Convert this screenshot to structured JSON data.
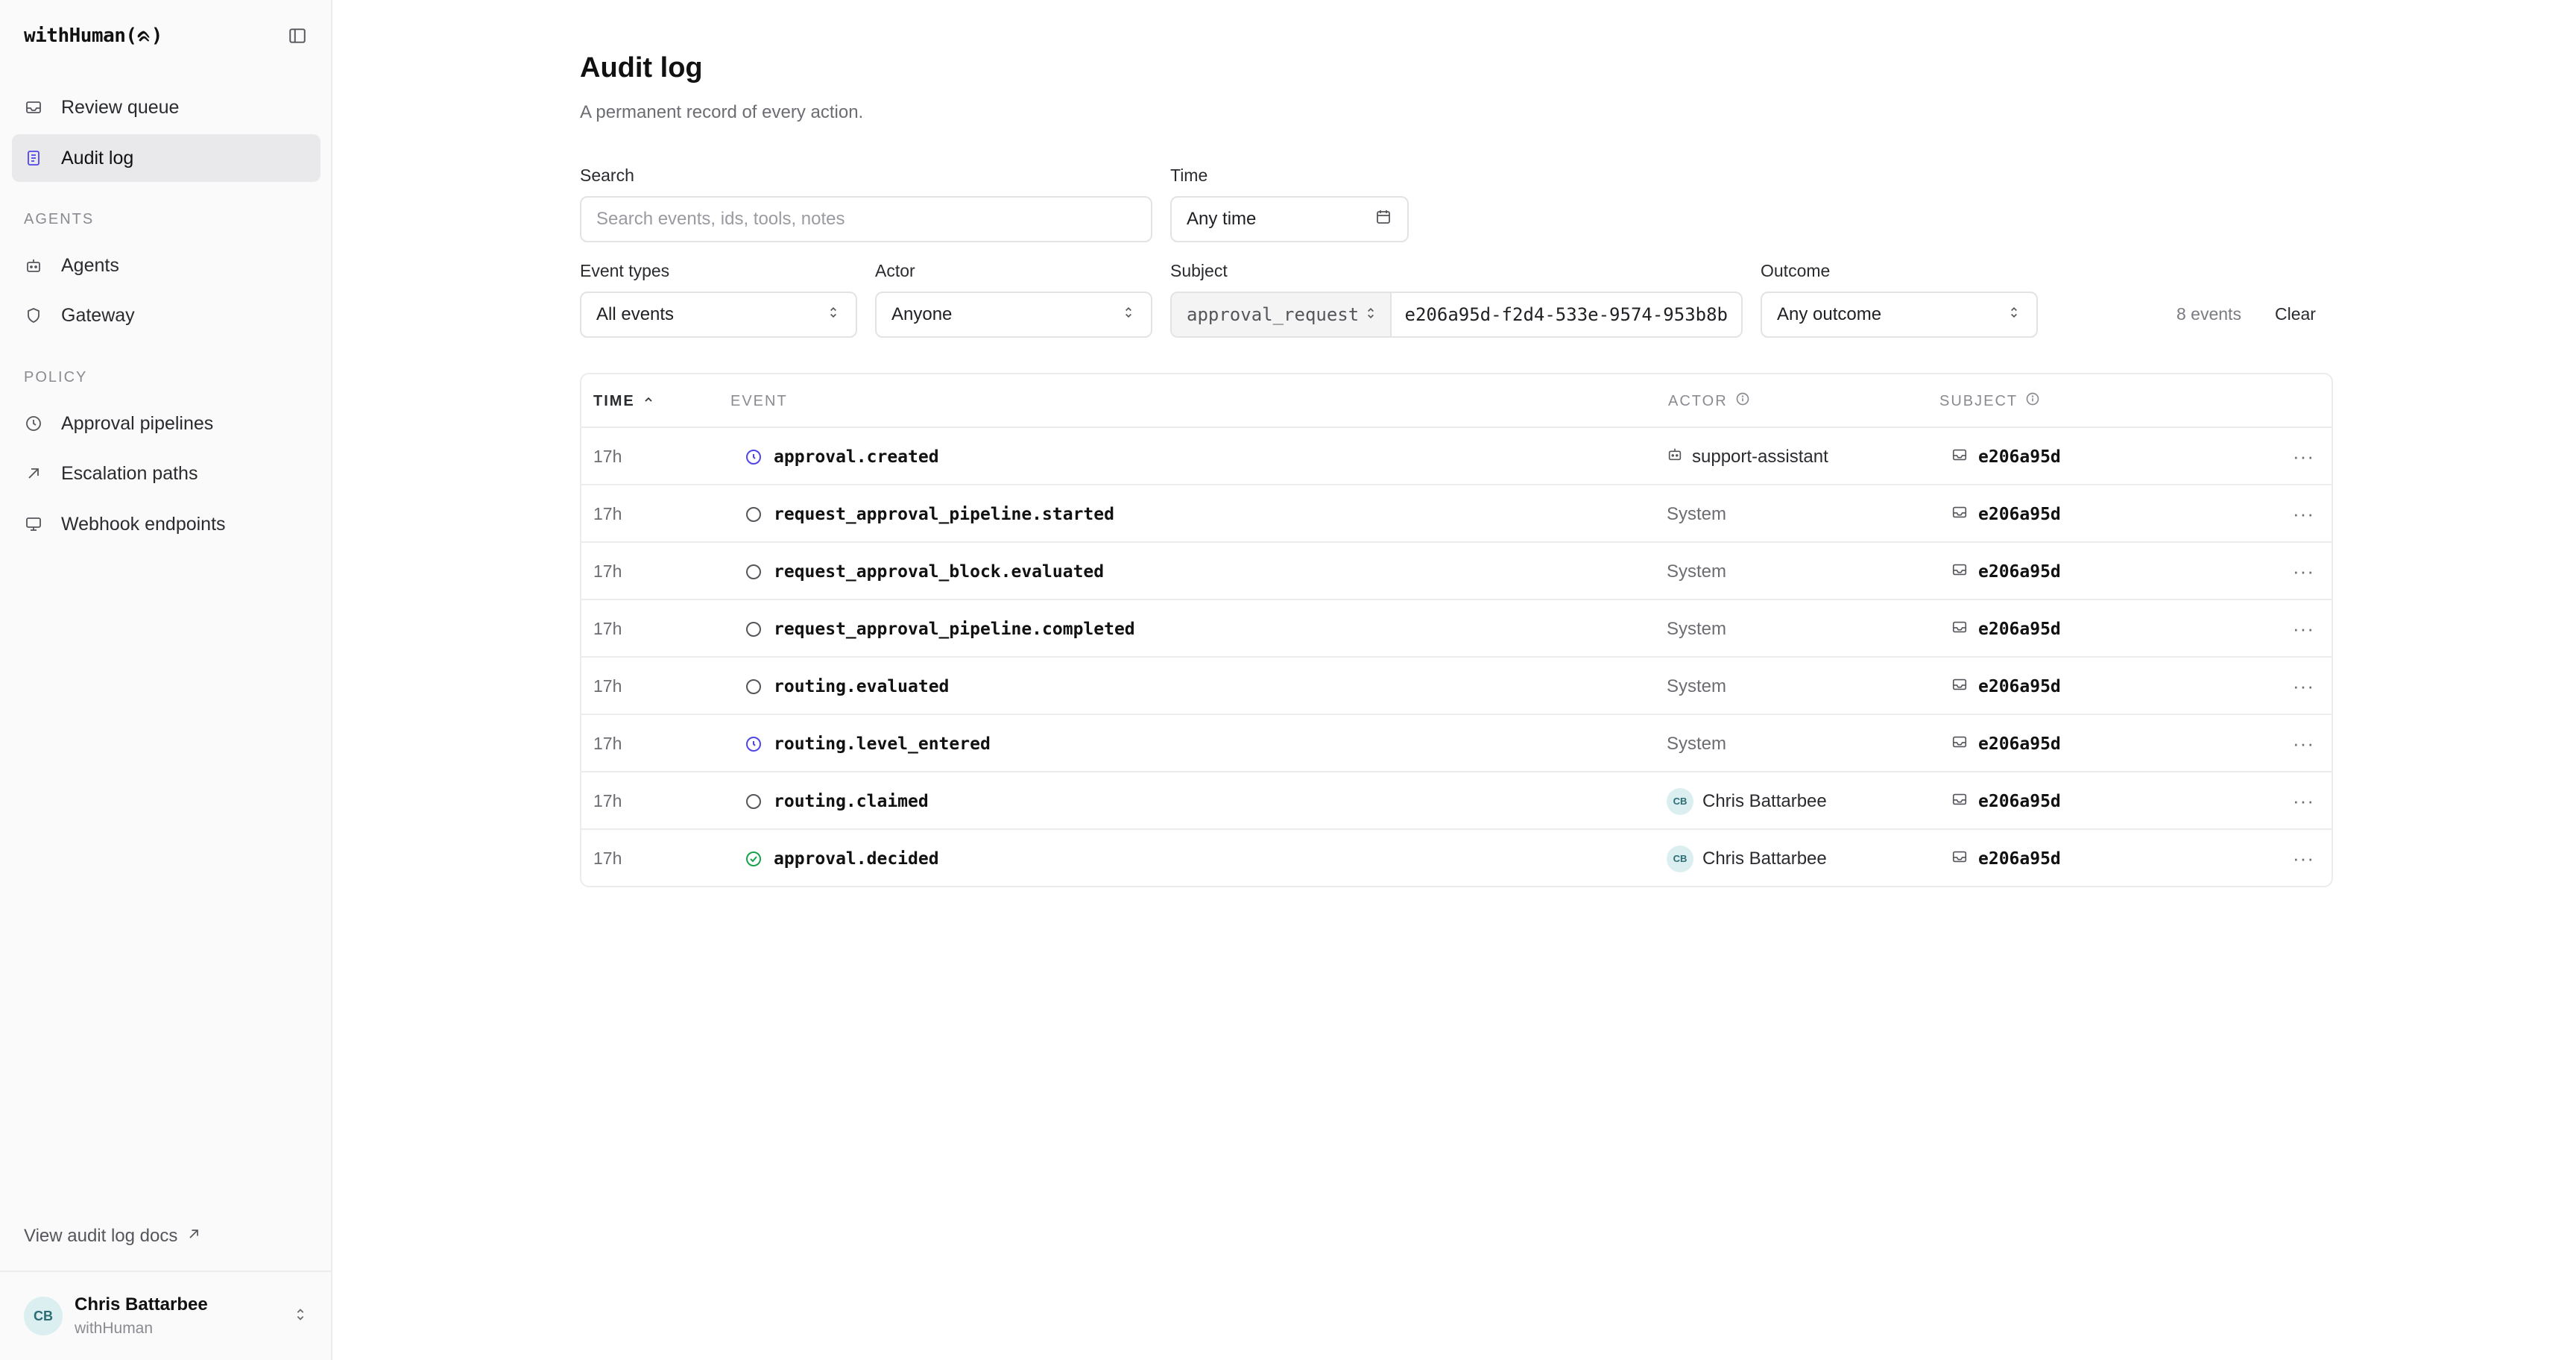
{
  "app": {
    "brand": "withHuman(ᨑ)"
  },
  "sidebar": {
    "nav": [
      {
        "label": "Review queue",
        "icon": "inbox-icon"
      },
      {
        "label": "Audit log",
        "icon": "document-icon",
        "active": true
      }
    ],
    "sections": [
      {
        "label": "AGENTS",
        "items": [
          {
            "label": "Agents",
            "icon": "robot-icon"
          },
          {
            "label": "Gateway",
            "icon": "shield-icon"
          }
        ]
      },
      {
        "label": "POLICY",
        "items": [
          {
            "label": "Approval pipelines",
            "icon": "clock-icon"
          },
          {
            "label": "Escalation paths",
            "icon": "arrow-up-right-icon"
          },
          {
            "label": "Webhook endpoints",
            "icon": "monitor-icon"
          }
        ]
      }
    ],
    "docs_link": "View audit log docs",
    "user": {
      "initials": "CB",
      "name": "Chris Battarbee",
      "org": "withHuman"
    }
  },
  "page": {
    "title": "Audit log",
    "subtitle": "A permanent record of every action."
  },
  "filters": {
    "search": {
      "label": "Search",
      "placeholder": "Search events, ids, tools, notes"
    },
    "time": {
      "label": "Time",
      "value": "Any time"
    },
    "event_types": {
      "label": "Event types",
      "value": "All events"
    },
    "actor": {
      "label": "Actor",
      "value": "Anyone"
    },
    "subject": {
      "label": "Subject",
      "type": "approval_request",
      "id": "e206a95d-f2d4-533e-9574-953b8b"
    },
    "outcome": {
      "label": "Outcome",
      "value": "Any outcome"
    },
    "count": "8 events",
    "clear": "Clear"
  },
  "table": {
    "headers": {
      "time": "TIME",
      "event": "EVENT",
      "actor": "ACTOR",
      "subject": "SUBJECT"
    },
    "rows": [
      {
        "time": "17h",
        "event": "approval.created",
        "status": "pending",
        "actor": "support-assistant",
        "actor_type": "agent",
        "subject": "e206a95d"
      },
      {
        "time": "17h",
        "event": "request_approval_pipeline.started",
        "status": "neutral",
        "actor": "System",
        "actor_type": "system",
        "subject": "e206a95d"
      },
      {
        "time": "17h",
        "event": "request_approval_block.evaluated",
        "status": "neutral",
        "actor": "System",
        "actor_type": "system",
        "subject": "e206a95d"
      },
      {
        "time": "17h",
        "event": "request_approval_pipeline.completed",
        "status": "neutral",
        "actor": "System",
        "actor_type": "system",
        "subject": "e206a95d"
      },
      {
        "time": "17h",
        "event": "routing.evaluated",
        "status": "neutral",
        "actor": "System",
        "actor_type": "system",
        "subject": "e206a95d"
      },
      {
        "time": "17h",
        "event": "routing.level_entered",
        "status": "pending",
        "actor": "System",
        "actor_type": "system",
        "subject": "e206a95d"
      },
      {
        "time": "17h",
        "event": "routing.claimed",
        "status": "neutral",
        "actor": "Chris Battarbee",
        "actor_type": "user",
        "actor_initials": "CB",
        "subject": "e206a95d"
      },
      {
        "time": "17h",
        "event": "approval.decided",
        "status": "success",
        "actor": "Chris Battarbee",
        "actor_type": "user",
        "actor_initials": "CB",
        "subject": "e206a95d"
      }
    ],
    "more_label": "···"
  },
  "colors": {
    "pending": "#4f46e5",
    "neutral": "#55565c",
    "success": "#16a34a",
    "active_nav_bg": "#e9e9ec"
  }
}
